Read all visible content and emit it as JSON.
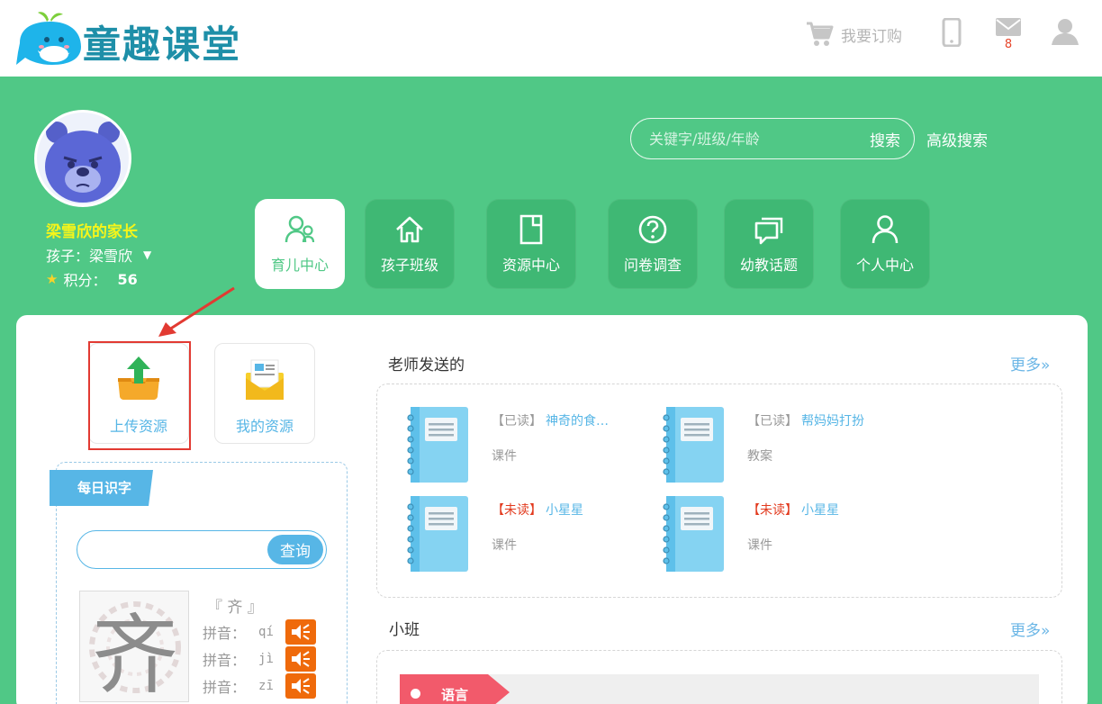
{
  "header": {
    "logo_text": "童趣课堂",
    "cart_label": "我要订购",
    "mail_count": "8"
  },
  "profile": {
    "parent_name": "梁雪欣的家长",
    "child_label": "孩子：梁雪欣",
    "points_label": "积分：",
    "points_value": "56"
  },
  "search": {
    "placeholder": "关键字/班级/年龄",
    "button": "搜索",
    "advanced": "高级搜索"
  },
  "nav": [
    {
      "label": "育儿中心",
      "icon": "parenting-icon",
      "active": true
    },
    {
      "label": "孩子班级",
      "icon": "home-icon"
    },
    {
      "label": "资源中心",
      "icon": "document-icon"
    },
    {
      "label": "问卷调查",
      "icon": "question-icon"
    },
    {
      "label": "幼教话题",
      "icon": "chat-icon"
    },
    {
      "label": "个人中心",
      "icon": "person-icon"
    }
  ],
  "resources": {
    "upload": "上传资源",
    "mine": "我的资源"
  },
  "daily": {
    "title": "每日识字",
    "lookup_button": "查询",
    "character": "齐",
    "char_title": "『 齐 』",
    "pinyin_label": "拼音：",
    "pinyin": [
      "qí",
      "jì",
      "zī"
    ]
  },
  "teacher_sent": {
    "title": "老师发送的",
    "more": "更多»",
    "items": [
      {
        "status": "【已读】",
        "status_type": "read",
        "name": "神奇的食…",
        "type": "课件"
      },
      {
        "status": "【已读】",
        "status_type": "read",
        "name": "帮妈妈打扮",
        "type": "教案"
      },
      {
        "status": "【未读】",
        "status_type": "unread",
        "name": "小星星",
        "type": "课件"
      },
      {
        "status": "【未读】",
        "status_type": "unread",
        "name": "小星星",
        "type": "课件"
      }
    ]
  },
  "class_section": {
    "title": "小班",
    "more": "更多»",
    "subject": "语言"
  },
  "colors": {
    "green": "#50c886",
    "blue": "#57b6e6",
    "highlight_red": "#e23a32",
    "unread": "#e23a1e",
    "yellow_name": "#f6f51a"
  }
}
